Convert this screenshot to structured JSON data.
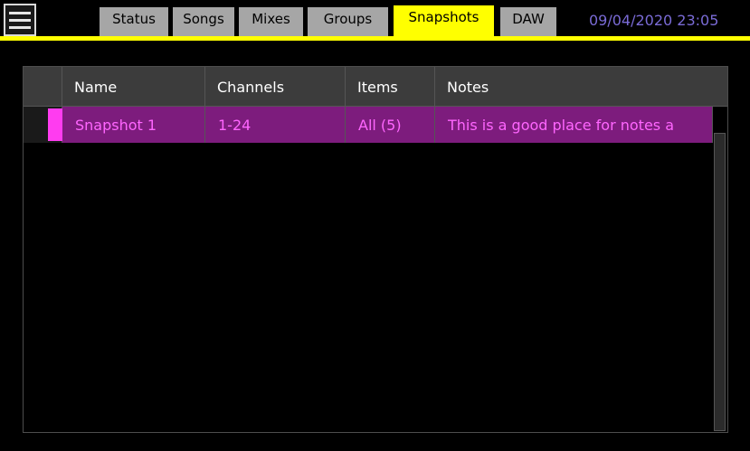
{
  "tabs": [
    {
      "label": "Status",
      "active": false
    },
    {
      "label": "Songs",
      "active": false
    },
    {
      "label": "Mixes",
      "active": false
    },
    {
      "label": "Groups",
      "active": false
    },
    {
      "label": "Snapshots",
      "active": true
    },
    {
      "label": "DAW",
      "active": false
    }
  ],
  "datetime": "09/04/2020 23:05",
  "table": {
    "columns": [
      "Name",
      "Channels",
      "Items",
      "Notes"
    ],
    "rows": [
      {
        "name": "Snapshot 1",
        "channels": "1-24",
        "items": "All (5)",
        "notes": "This is a good place for notes a"
      }
    ]
  },
  "colors": {
    "accent": "#ffff00",
    "selected_row": "#7d1c7d",
    "selected_text": "#ff66ff",
    "marker": "#ff3cf0",
    "datetime": "#7a6bd6"
  },
  "icons": {
    "menu": "hamburger-menu-icon"
  }
}
